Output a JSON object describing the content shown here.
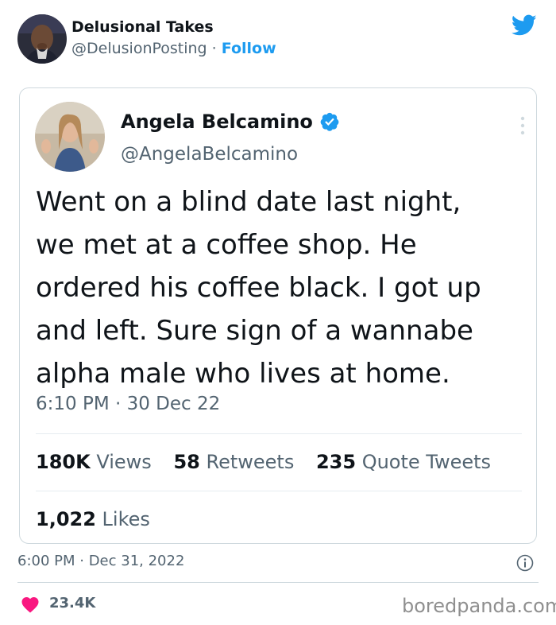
{
  "post": {
    "author_name": "Delusional Takes",
    "author_handle": "@DelusionPosting",
    "separator": " · ",
    "follow_label": "Follow",
    "timestamp": "6:00 PM · Dec 31, 2022",
    "like_count": "23.4K"
  },
  "quoted_tweet": {
    "author_name": "Angela Belcamino",
    "author_handle": "@AngelaBelcamino",
    "text": "Went on a blind date last night,\nwe met at a coffee shop. He\nordered his coffee black. I got up\nand left. Sure sign of a wannabe\nalpha male who lives at home.",
    "timestamp": "6:10 PM · 30 Dec 22",
    "views_count": "180K",
    "views_label": " Views",
    "retweets_count": "58",
    "retweets_label": " Retweets",
    "quotes_count": "235",
    "quotes_label": " Quote Tweets",
    "likes_count": "1,022",
    "likes_label": " Likes"
  },
  "watermark": "boredpanda.com",
  "icons": {
    "brand": "twitter-bird-icon",
    "verified": "verified-badge-icon",
    "more": "more-options-icon",
    "info": "info-icon",
    "like": "heart-icon"
  },
  "colors": {
    "twitter_blue": "#1d9bf0",
    "heart_pink": "#f91880",
    "secondary_text": "#536471",
    "primary_text": "#0f1419"
  }
}
